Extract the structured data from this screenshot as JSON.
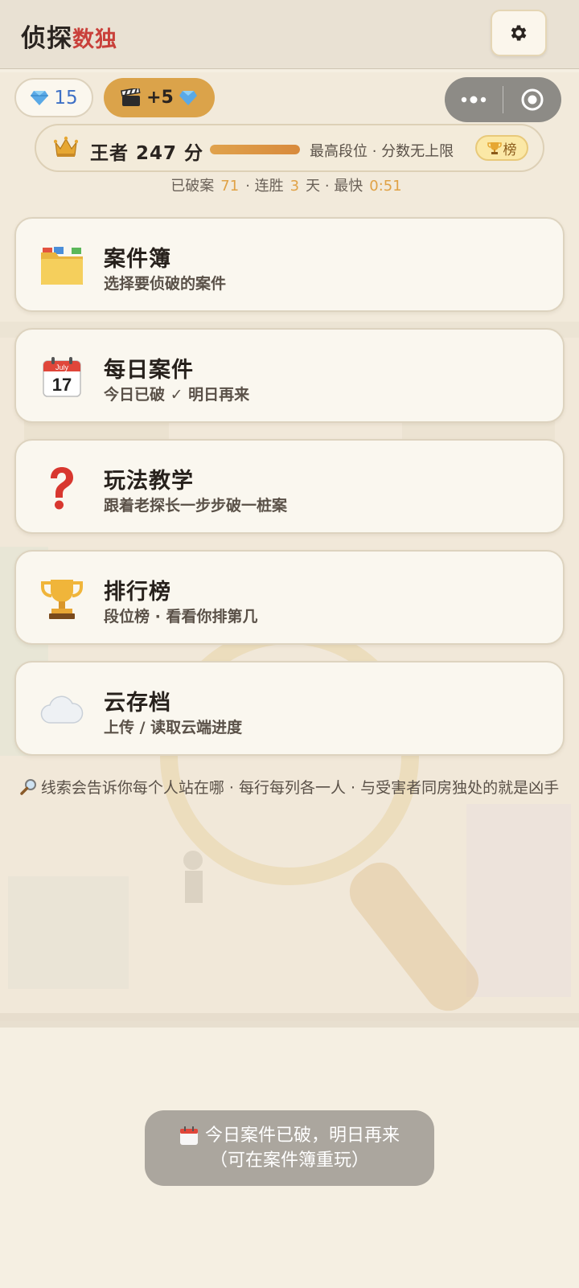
{
  "header": {
    "title_main": "侦探",
    "title_accent": "数独",
    "settings_icon": "gear-icon"
  },
  "currency": {
    "gems": "15",
    "ad_reward": "+5",
    "gem_icon": "diamond-icon",
    "ad_icon": "clapperboard-icon"
  },
  "rank": {
    "label": "王者 247 分",
    "progress": 1.0,
    "note": "最高段位 · 分数无上限",
    "board_label": "榜",
    "crown_icon": "crown-icon"
  },
  "stats": {
    "solved_label": "已破案",
    "solved_value": "71",
    "streak_label": "· 连胜",
    "streak_value": "3",
    "streak_unit": "天 · 最快",
    "fastest_value": "0:51"
  },
  "menu": [
    {
      "title": "案件簿",
      "subtitle": "选择要侦破的案件",
      "icon": "folder-icon"
    },
    {
      "title": "每日案件",
      "subtitle": "今日已破 ✓ 明日再来",
      "icon": "calendar-icon"
    },
    {
      "title": "玩法教学",
      "subtitle": "跟着老探长一步步破一桩案",
      "icon": "question-icon"
    },
    {
      "title": "排行榜",
      "subtitle": "段位榜 · 看看你排第几",
      "icon": "trophy-icon"
    },
    {
      "title": "云存档",
      "subtitle": "上传 / 读取云端进度",
      "icon": "cloud-icon"
    }
  ],
  "calendar_badge": {
    "month": "July",
    "day": "17"
  },
  "hint": "线索会告诉你每个人站在哪 · 每行每列各一人 · 与受害者同房独处的就是凶手",
  "toast": {
    "line1": "今日案件已破，明日再来",
    "line2": "（可在案件簿重玩）"
  },
  "colors": {
    "accent_red": "#c9403a",
    "gold": "#dba34a",
    "gem_blue": "#3e70c6"
  }
}
